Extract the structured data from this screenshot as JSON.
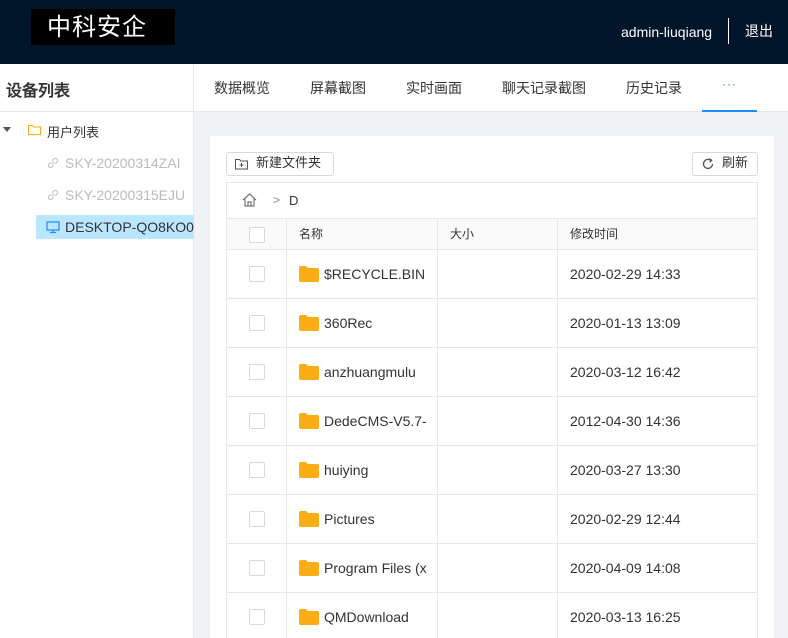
{
  "header": {
    "logo_text": "中科安企",
    "username": "admin-liuqiang",
    "logout_label": "退出"
  },
  "sidebar": {
    "title": "设备列表",
    "tree_root": "用户列表",
    "devices": [
      {
        "label": "SKY-20200314ZAI",
        "status": "offline"
      },
      {
        "label": "SKY-20200315EJU",
        "status": "offline"
      },
      {
        "label": "DESKTOP-QO8KO0",
        "status": "online",
        "selected": true
      }
    ]
  },
  "tabs": [
    {
      "label": "数据概览"
    },
    {
      "label": "屏幕截图"
    },
    {
      "label": "实时画面"
    },
    {
      "label": "聊天记录截图"
    },
    {
      "label": "历史记录"
    },
    {
      "label": "···",
      "active": true
    }
  ],
  "toolbar": {
    "new_folder_label": "新建文件夹",
    "refresh_label": "刷新"
  },
  "breadcrumb": {
    "separator": ">",
    "current": "D"
  },
  "table": {
    "columns": [
      "名称",
      "大小",
      "修改时间"
    ],
    "rows": [
      {
        "name": "$RECYCLE.BIN",
        "size": "",
        "modified": "2020-02-29 14:33"
      },
      {
        "name": "360Rec",
        "size": "",
        "modified": "2020-01-13 13:09"
      },
      {
        "name": "anzhuangmulu",
        "size": "",
        "modified": "2020-03-12 16:42"
      },
      {
        "name": "DedeCMS-V5.7-",
        "size": "",
        "modified": "2012-04-30 14:36"
      },
      {
        "name": "huiying",
        "size": "",
        "modified": "2020-03-27 13:30"
      },
      {
        "name": "Pictures",
        "size": "",
        "modified": "2020-02-29 12:44"
      },
      {
        "name": "Program Files (x",
        "size": "",
        "modified": "2020-04-09 14:08"
      },
      {
        "name": "QMDownload",
        "size": "",
        "modified": "2020-03-13 16:25"
      }
    ]
  },
  "colors": {
    "header_bg": "#001529",
    "accent": "#1890ff",
    "selected_bg": "#bae7ff",
    "folder": "#faad14",
    "content_bg": "#f0f2f5"
  }
}
